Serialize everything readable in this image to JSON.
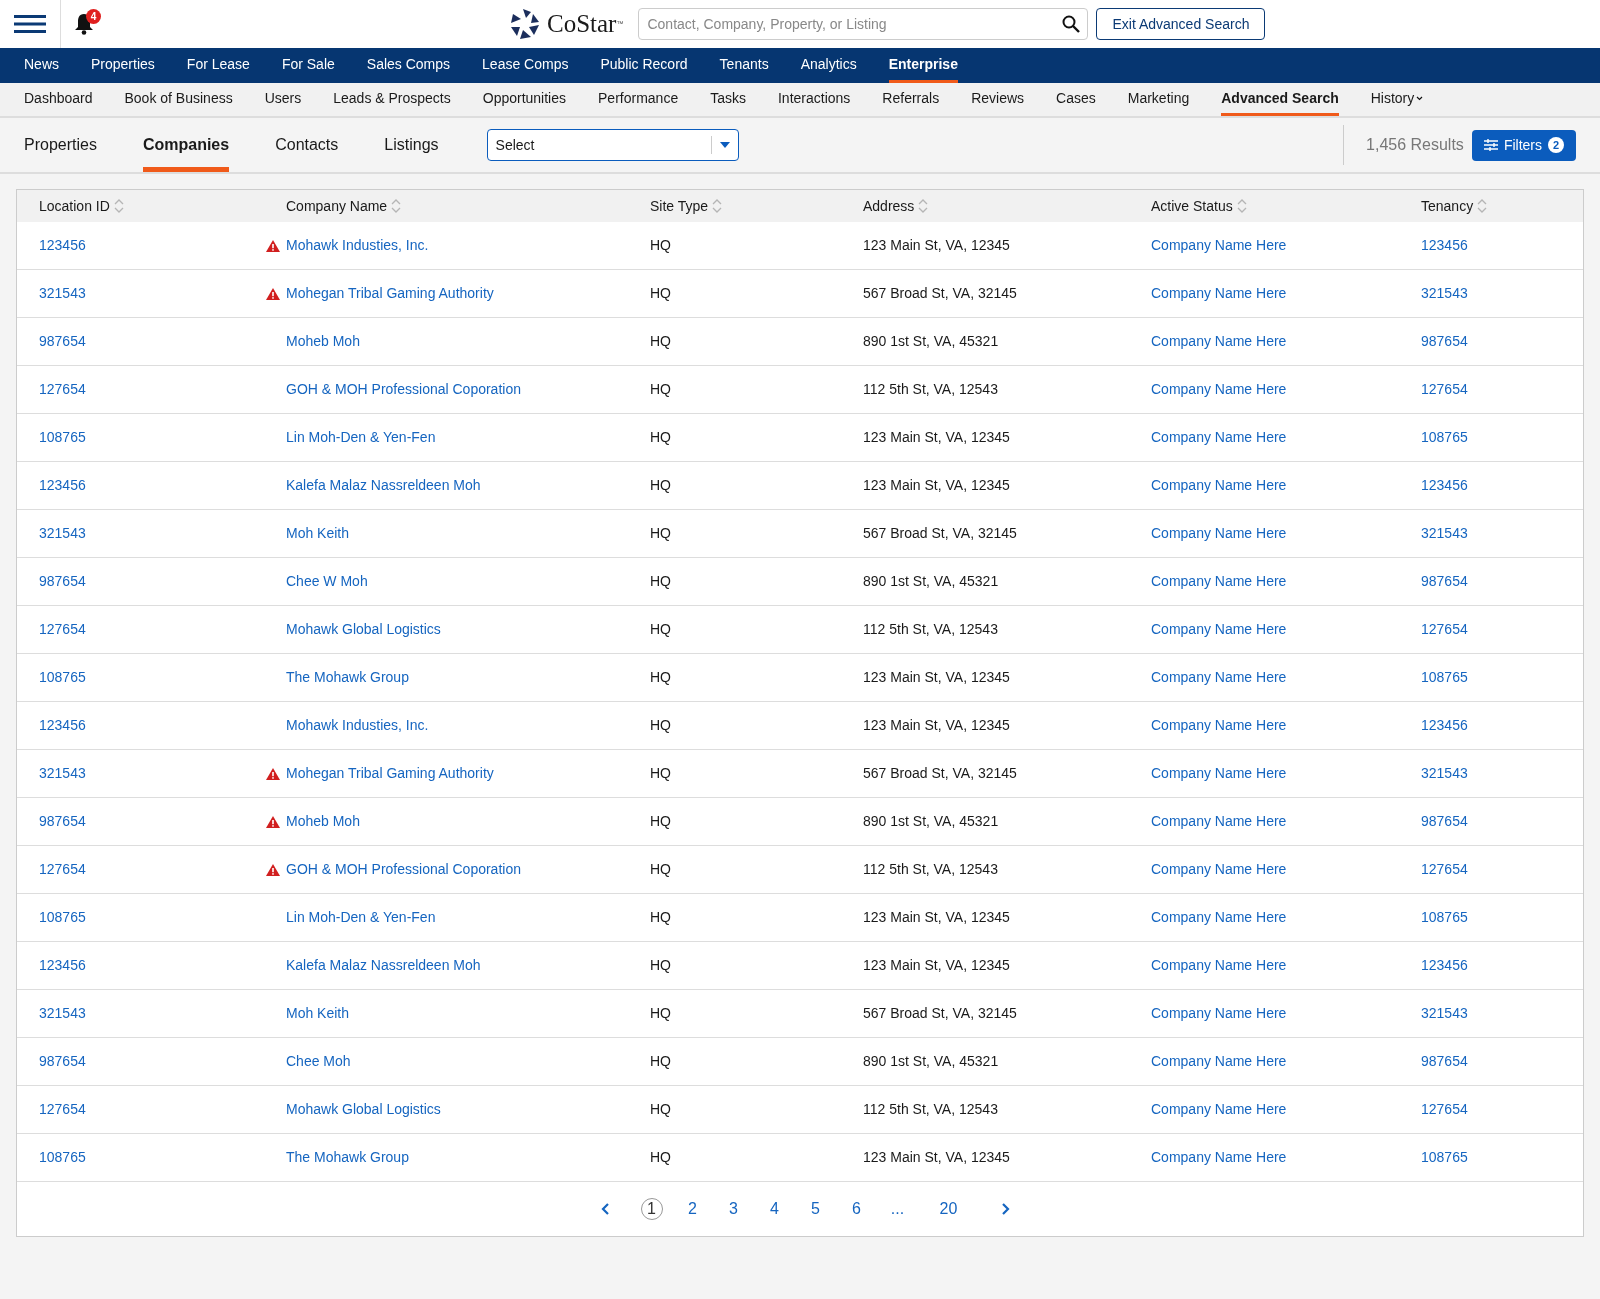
{
  "header": {
    "notification_count": "4",
    "logo_text": "CoStar",
    "logo_mark": "™",
    "search": {
      "placeholder": "Contact, Company, Property, or Listing"
    },
    "exit_button": "Exit Advanced Search"
  },
  "main_nav": [
    {
      "label": "News",
      "selected": false
    },
    {
      "label": "Properties",
      "selected": false
    },
    {
      "label": "For Lease",
      "selected": false
    },
    {
      "label": "For Sale",
      "selected": false
    },
    {
      "label": "Sales Comps",
      "selected": false
    },
    {
      "label": "Lease Comps",
      "selected": false
    },
    {
      "label": "Public Record",
      "selected": false
    },
    {
      "label": "Tenants",
      "selected": false
    },
    {
      "label": "Analytics",
      "selected": false
    },
    {
      "label": "Enterprise",
      "selected": true
    }
  ],
  "sub_nav": [
    {
      "label": "Dashboard",
      "selected": false
    },
    {
      "label": "Book of Business",
      "selected": false
    },
    {
      "label": "Users",
      "selected": false
    },
    {
      "label": "Leads & Prospects",
      "selected": false
    },
    {
      "label": "Opportunities",
      "selected": false
    },
    {
      "label": "Performance",
      "selected": false
    },
    {
      "label": "Tasks",
      "selected": false
    },
    {
      "label": "Interactions",
      "selected": false
    },
    {
      "label": "Referrals",
      "selected": false
    },
    {
      "label": "Reviews",
      "selected": false
    },
    {
      "label": "Cases",
      "selected": false
    },
    {
      "label": "Marketing",
      "selected": false
    },
    {
      "label": "Advanced Search",
      "selected": true
    },
    {
      "label": "History",
      "selected": false,
      "dropdown": true
    }
  ],
  "tabs": [
    {
      "label": "Properties",
      "selected": false
    },
    {
      "label": "Companies",
      "selected": true
    },
    {
      "label": "Contacts",
      "selected": false
    },
    {
      "label": "Listings",
      "selected": false
    }
  ],
  "select": {
    "value": "Select"
  },
  "results": "1,456 Results",
  "filters": {
    "label": "Filters",
    "count": "2"
  },
  "table": {
    "columns": [
      "Location ID",
      "Company Name",
      "Site Type",
      "Address",
      "Active Status",
      "Tenancy"
    ],
    "rows": [
      {
        "id": "123456",
        "warning": true,
        "company": "Mohawk Industies, Inc.",
        "site": "HQ",
        "address": "123 Main St, VA, 12345",
        "status": "Company Name Here",
        "tenancy": "123456"
      },
      {
        "id": "321543",
        "warning": true,
        "company": "Mohegan Tribal Gaming Authority",
        "site": "HQ",
        "address": "567 Broad St, VA, 32145",
        "status": "Company Name Here",
        "tenancy": "321543"
      },
      {
        "id": "987654",
        "warning": false,
        "company": "Moheb Moh",
        "site": "HQ",
        "address": "890 1st St, VA, 45321",
        "status": "Company Name Here",
        "tenancy": "987654"
      },
      {
        "id": "127654",
        "warning": false,
        "company": "GOH & MOH Professional Coporation",
        "site": "HQ",
        "address": "112 5th St, VA, 12543",
        "status": "Company Name Here",
        "tenancy": "127654"
      },
      {
        "id": "108765",
        "warning": false,
        "company": "Lin Moh-Den & Yen-Fen",
        "site": "HQ",
        "address": "123 Main St, VA, 12345",
        "status": "Company Name Here",
        "tenancy": "108765"
      },
      {
        "id": "123456",
        "warning": false,
        "company": "Kalefa Malaz Nassreldeen Moh",
        "site": "HQ",
        "address": "123 Main St, VA, 12345",
        "status": "Company Name Here",
        "tenancy": "123456"
      },
      {
        "id": "321543",
        "warning": false,
        "company": "Moh Keith",
        "site": "HQ",
        "address": "567 Broad St, VA, 32145",
        "status": "Company Name Here",
        "tenancy": "321543"
      },
      {
        "id": "987654",
        "warning": false,
        "company": "Chee W Moh",
        "site": "HQ",
        "address": "890 1st St, VA, 45321",
        "status": "Company Name Here",
        "tenancy": "987654"
      },
      {
        "id": "127654",
        "warning": false,
        "company": "Mohawk Global Logistics",
        "site": "HQ",
        "address": "112 5th St, VA, 12543",
        "status": "Company Name Here",
        "tenancy": "127654"
      },
      {
        "id": "108765",
        "warning": false,
        "company": "The Mohawk Group",
        "site": "HQ",
        "address": "123 Main St, VA, 12345",
        "status": "Company Name Here",
        "tenancy": "108765"
      },
      {
        "id": "123456",
        "warning": false,
        "company": "Mohawk Industies, Inc.",
        "site": "HQ",
        "address": "123 Main St, VA, 12345",
        "status": "Company Name Here",
        "tenancy": "123456"
      },
      {
        "id": "321543",
        "warning": true,
        "company": "Mohegan Tribal Gaming Authority",
        "site": "HQ",
        "address": "567 Broad St, VA, 32145",
        "status": "Company Name Here",
        "tenancy": "321543"
      },
      {
        "id": "987654",
        "warning": true,
        "company": "Moheb Moh",
        "site": "HQ",
        "address": "890 1st St, VA, 45321",
        "status": "Company Name Here",
        "tenancy": "987654"
      },
      {
        "id": "127654",
        "warning": true,
        "company": "GOH & MOH Professional Coporation",
        "site": "HQ",
        "address": "112 5th St, VA, 12543",
        "status": "Company Name Here",
        "tenancy": "127654"
      },
      {
        "id": "108765",
        "warning": false,
        "company": "Lin Moh-Den & Yen-Fen",
        "site": "HQ",
        "address": "123 Main St, VA, 12345",
        "status": "Company Name Here",
        "tenancy": "108765"
      },
      {
        "id": "123456",
        "warning": false,
        "company": "Kalefa Malaz Nassreldeen Moh",
        "site": "HQ",
        "address": "123 Main St, VA, 12345",
        "status": "Company Name Here",
        "tenancy": "123456"
      },
      {
        "id": "321543",
        "warning": false,
        "company": "Moh Keith",
        "site": "HQ",
        "address": "567 Broad St, VA, 32145",
        "status": "Company Name Here",
        "tenancy": "321543"
      },
      {
        "id": "987654",
        "warning": false,
        "company": "Chee Moh",
        "site": "HQ",
        "address": "890 1st St, VA, 45321",
        "status": "Company Name Here",
        "tenancy": "987654"
      },
      {
        "id": "127654",
        "warning": false,
        "company": "Mohawk Global Logistics",
        "site": "HQ",
        "address": "112 5th St, VA, 12543",
        "status": "Company Name Here",
        "tenancy": "127654"
      },
      {
        "id": "108765",
        "warning": false,
        "company": "The Mohawk Group",
        "site": "HQ",
        "address": "123 Main St, VA, 12345",
        "status": "Company Name Here",
        "tenancy": "108765"
      }
    ]
  },
  "pagination": [
    {
      "label": "1",
      "selected": true
    },
    {
      "label": "2",
      "selected": false
    },
    {
      "label": "3",
      "selected": false
    },
    {
      "label": "4",
      "selected": false
    },
    {
      "label": "5",
      "selected": false
    },
    {
      "label": "6",
      "selected": false
    },
    {
      "label": "...",
      "selected": false
    },
    {
      "label": "20",
      "selected": false
    }
  ]
}
